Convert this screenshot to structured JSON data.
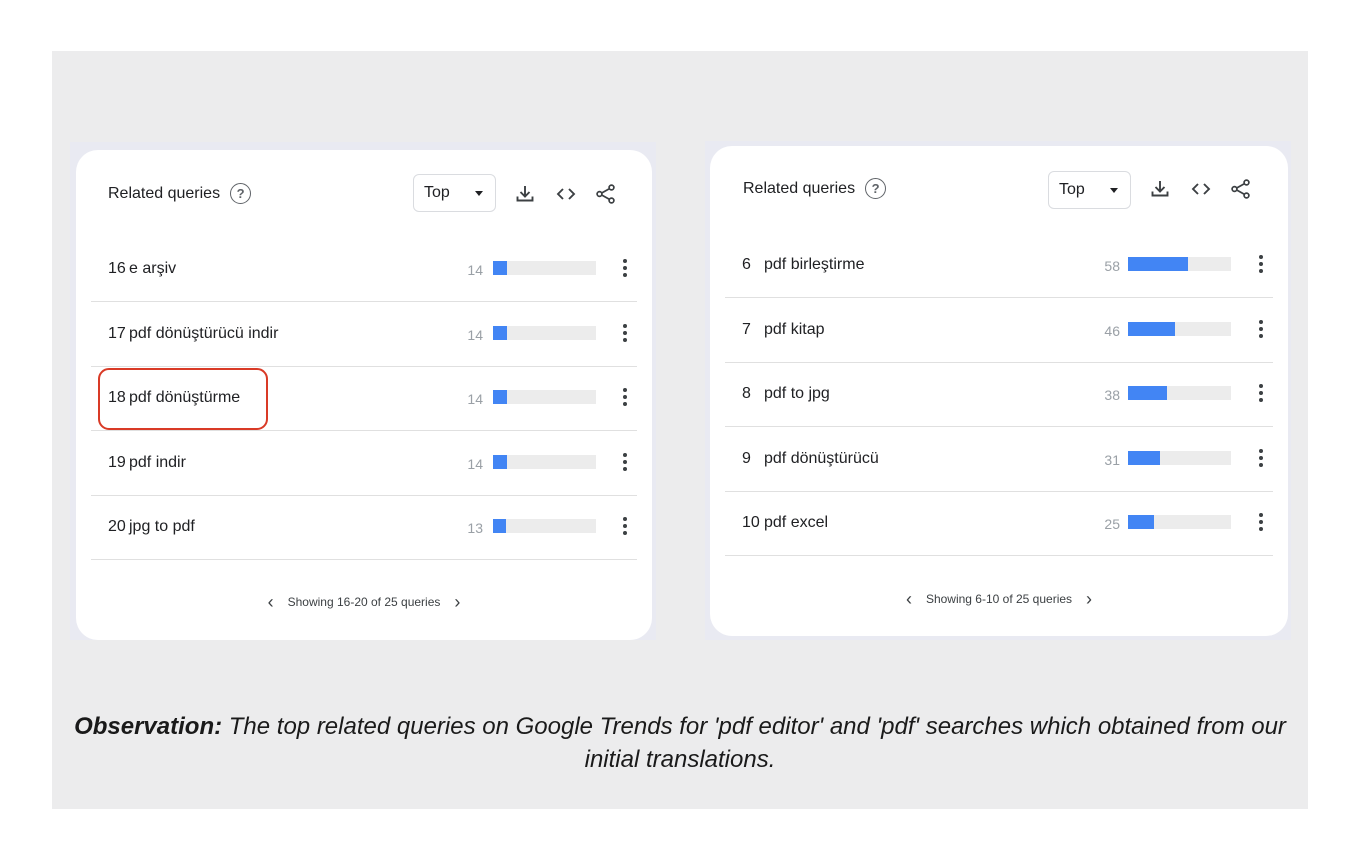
{
  "left_card": {
    "title": "Related queries",
    "help_glyph": "?",
    "filter": "Top",
    "rows": [
      {
        "index": "16",
        "query": "e arşiv",
        "value": "14",
        "fill": 0.14
      },
      {
        "index": "17",
        "query": "pdf dönüştürücü indir",
        "value": "14",
        "fill": 0.14
      },
      {
        "index": "18",
        "query": "pdf dönüştürme",
        "value": "14",
        "fill": 0.14
      },
      {
        "index": "19",
        "query": "pdf indir",
        "value": "14",
        "fill": 0.14
      },
      {
        "index": "20",
        "query": "jpg to pdf",
        "value": "13",
        "fill": 0.13
      }
    ],
    "pager_text": "Showing 16-20 of 25 queries"
  },
  "right_card": {
    "title": "Related queries",
    "help_glyph": "?",
    "filter": "Top",
    "rows": [
      {
        "index": "6",
        "query": "pdf birleştirme",
        "value": "58",
        "fill": 0.58
      },
      {
        "index": "7",
        "query": "pdf kitap",
        "value": "46",
        "fill": 0.46
      },
      {
        "index": "8",
        "query": "pdf to jpg",
        "value": "38",
        "fill": 0.38
      },
      {
        "index": "9",
        "query": "pdf dönüştürücü",
        "value": "31",
        "fill": 0.31
      },
      {
        "index": "10",
        "query": "pdf excel",
        "value": "25",
        "fill": 0.25
      }
    ],
    "pager_text": "Showing 6-10 of 25 queries"
  },
  "caption": {
    "label": "Observation:",
    "text": " The top related queries on Google Trends for 'pdf editor' and 'pdf' searches which obtained from our initial translations."
  },
  "colors": {
    "bar_fill": "#4285f4",
    "bar_track": "#ececec",
    "highlight": "#d93a26",
    "slide_bg": "#ececed"
  },
  "icons": [
    "help-icon",
    "dropdown-caret-icon",
    "download-icon",
    "embed-icon",
    "share-icon",
    "more-vert-icon",
    "chevron-left-icon",
    "chevron-right-icon"
  ]
}
